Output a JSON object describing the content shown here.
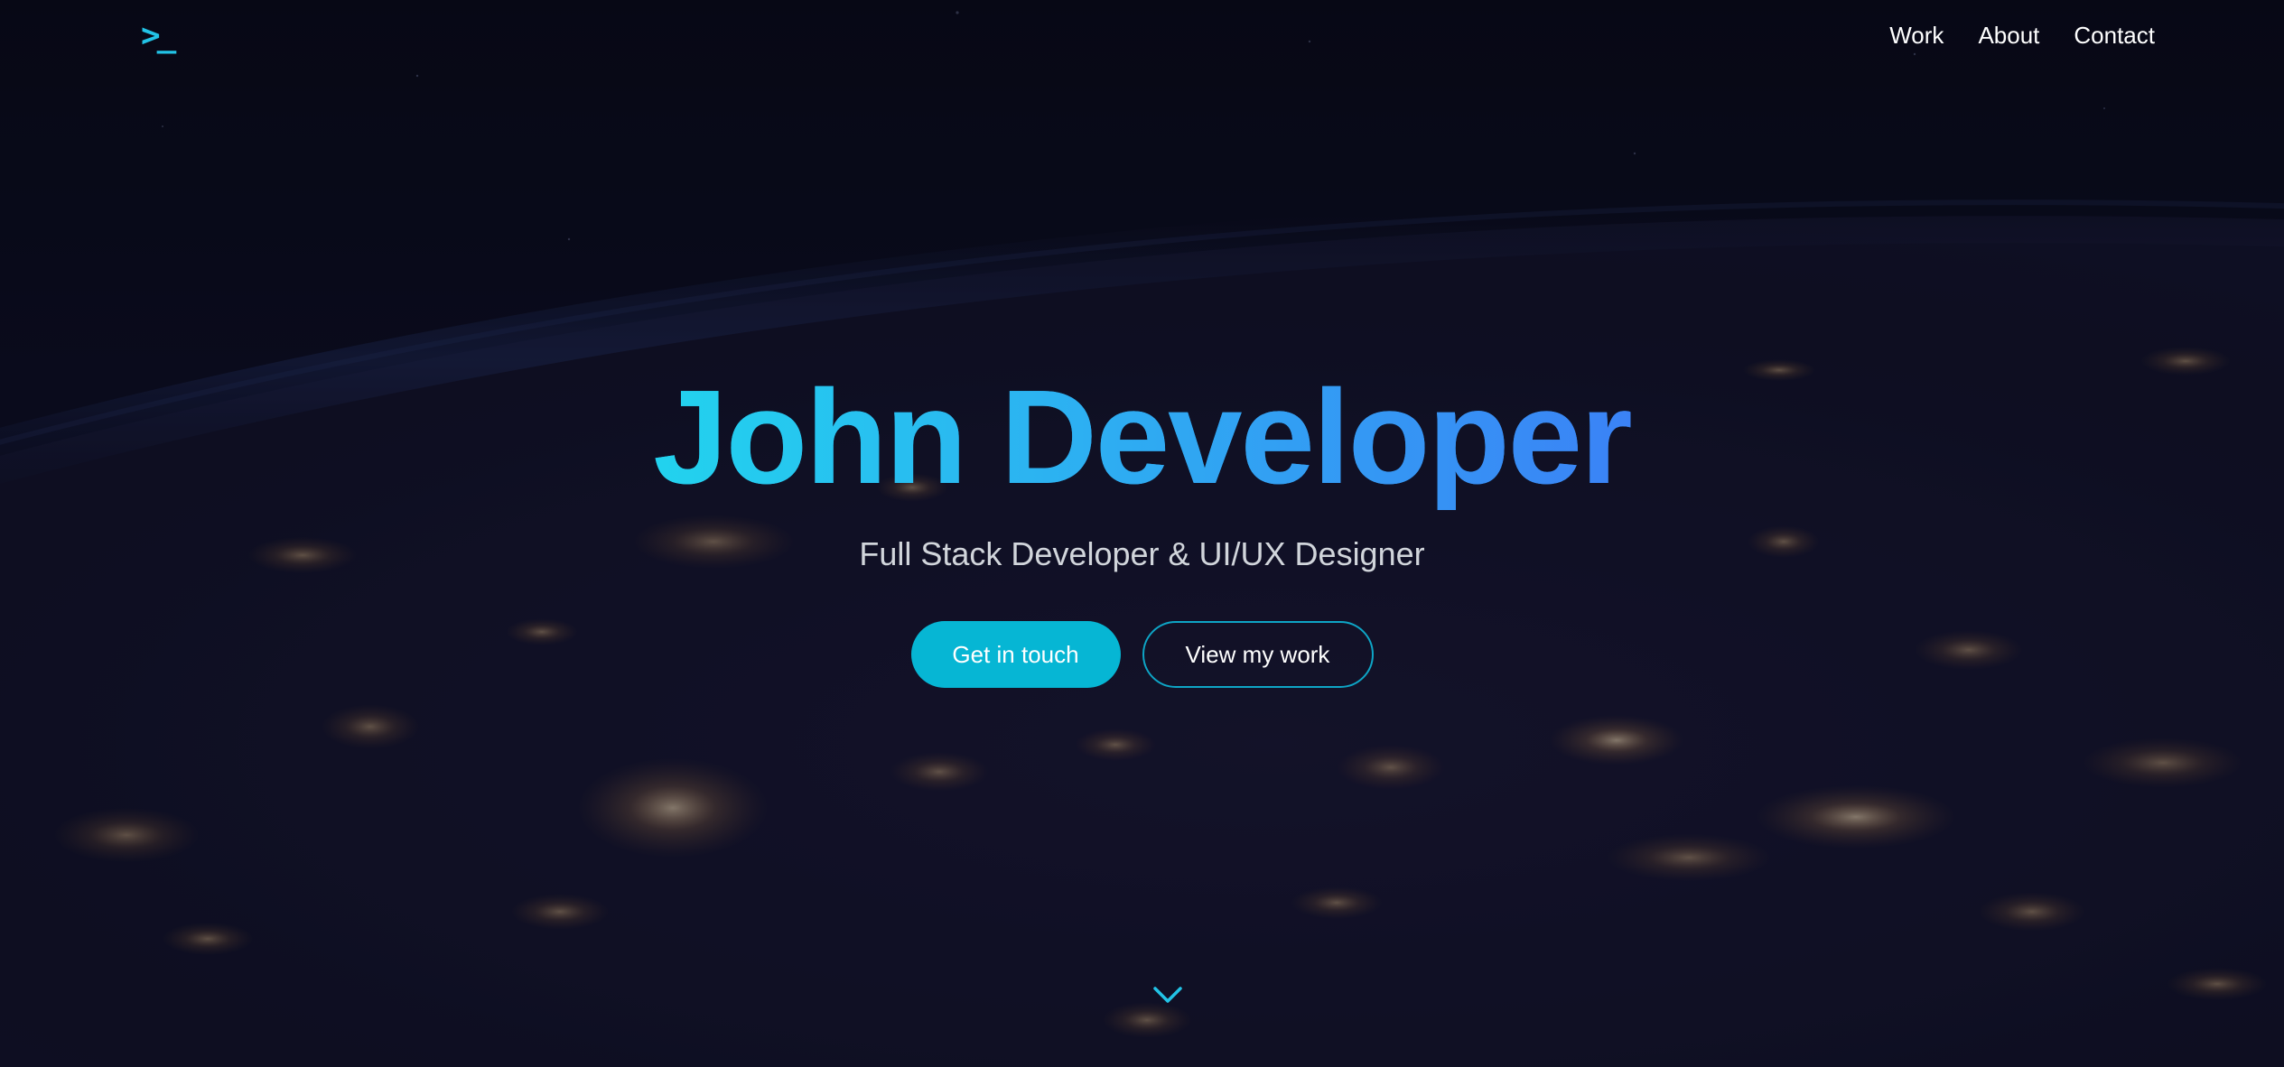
{
  "logo": {
    "glyph": ">_",
    "icon": "terminal-prompt-icon",
    "color": "#22c3e6"
  },
  "nav": {
    "items": [
      {
        "label": "Work"
      },
      {
        "label": "About"
      },
      {
        "label": "Contact"
      }
    ]
  },
  "hero": {
    "title": "John Developer",
    "subtitle": "Full Stack Developer & UI/UX Designer",
    "primary_button": "Get in touch",
    "secondary_button": "View my work",
    "scroll_icon": "chevron-down-icon"
  },
  "colors": {
    "background": "#0a0b18",
    "accent": "#06b6d4",
    "gradient_start": "#22d3ee",
    "gradient_end": "#3b82f6",
    "subtitle": "#d1d5db"
  }
}
